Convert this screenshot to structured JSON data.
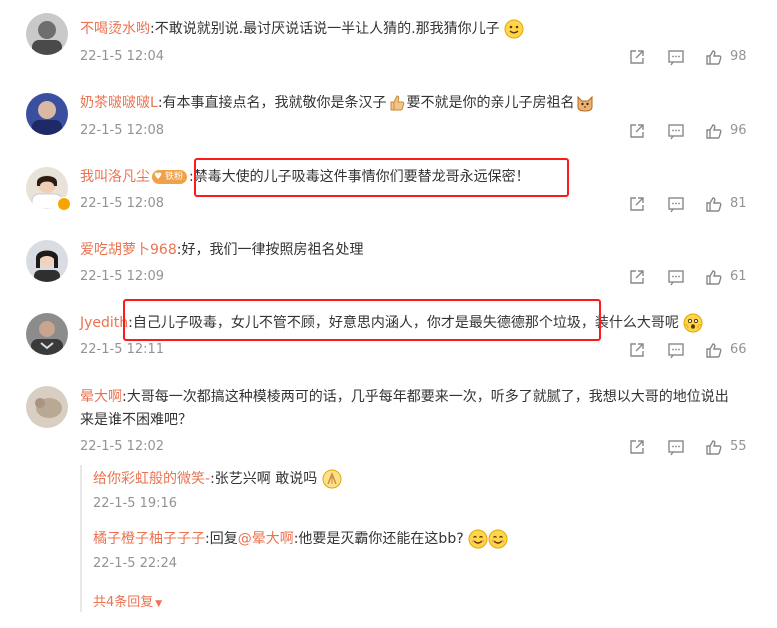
{
  "comments": [
    {
      "name": "不喝烫水哟",
      "text": ":不敢说就别说.最讨厌说话说一半让人猜的.那我猜你儿子",
      "time": "22-1-5 12:04",
      "likes": "98"
    },
    {
      "name": "奶茶啵啵啵L",
      "text": ":有本事直接点名，我就敬你是条汉子",
      "text2": "要不就是你的亲儿子房祖名",
      "time": "22-1-5 12:08",
      "likes": "96"
    },
    {
      "name": "我叫洛凡尘",
      "badge": "铁粉",
      "text": ":禁毒大使的儿子吸毒这件事情你们要替龙哥永远保密！",
      "time": "22-1-5 12:08",
      "likes": "81"
    },
    {
      "name": "爱吃胡萝卜968",
      "text": ":好，我们一律按照房祖名处理",
      "time": "22-1-5 12:09",
      "likes": "61"
    },
    {
      "name": "Jyedith",
      "text": ":自己儿子吸毒，女儿不管不顾，好意思内涵人，你才是最失德德那个垃圾，装什么大哥呢",
      "time": "22-1-5 12:11",
      "likes": "66"
    },
    {
      "name": "晕大啊",
      "text": ":大哥每一次都搞这种模棱两可的话，几乎每年都要来一次，听多了就腻了，我想以大哥的地位说出",
      "text2": "来是谁不困难吧？",
      "time": "22-1-5 12:02",
      "likes": "55"
    }
  ],
  "replies": [
    {
      "name": "给你彩虹般的微笑-",
      "text": ":张艺兴啊 敢说吗",
      "time": "22-1-5 19:16"
    },
    {
      "name": "橘子橙子柚子子子",
      "reply_word": ":回复",
      "mention": "@晕大啊",
      "text": ":他要是灭霸你还能在这bb?",
      "time": "22-1-5 22:24"
    }
  ],
  "more_replies": "共4条回复",
  "icons": [
    "share-icon",
    "comment-icon",
    "like-icon"
  ],
  "colors": {
    "name": "#eb7350",
    "meta": "#939393",
    "highlight": "#ff1a1a"
  }
}
